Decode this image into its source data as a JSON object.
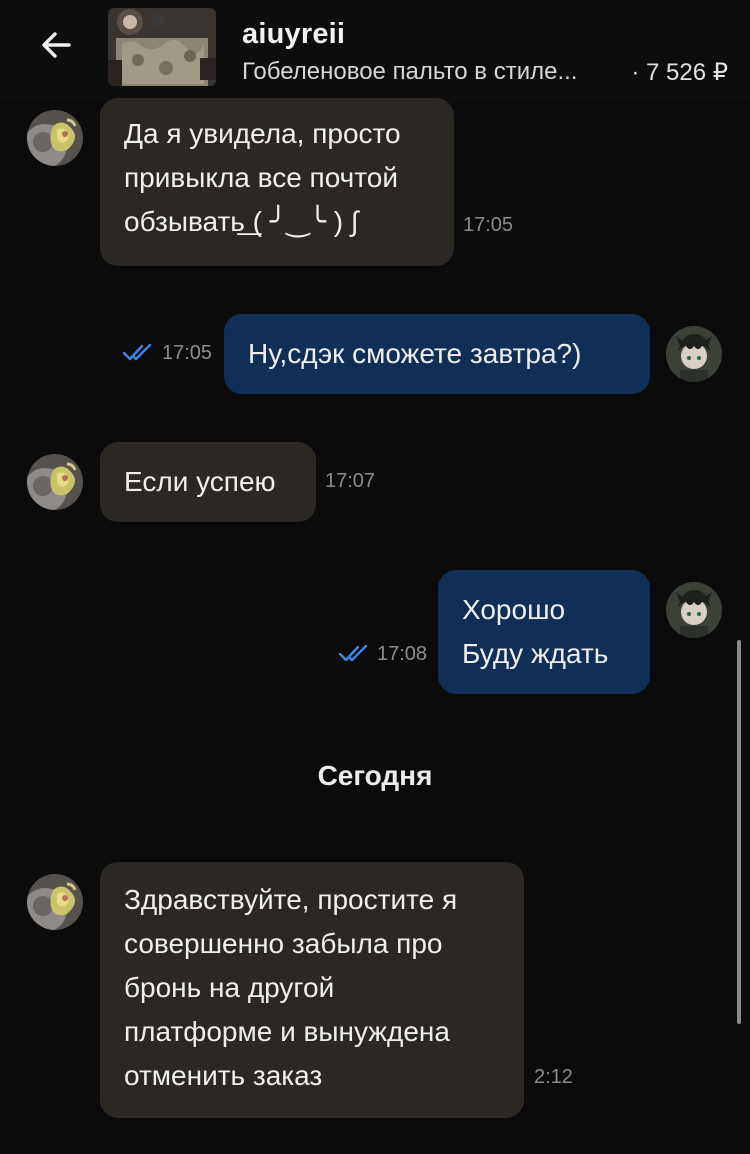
{
  "header": {
    "username": "aiuyreii",
    "product_title": "Гобеленовое пальто в стиле...",
    "price": "· 7 526 ₽",
    "back_icon": "arrow-left-icon"
  },
  "messages": [
    {
      "direction": "in",
      "lines": [
        "Да я увидела, просто",
        "привыкла все почтой",
        "обзывать͟  ( ╯‿╰ )  ∫"
      ],
      "time": "17:05"
    },
    {
      "direction": "out",
      "lines": [
        "Ну,сдэк сможете завтра?)"
      ],
      "time": "17:05",
      "read": true
    },
    {
      "direction": "in",
      "lines": [
        "Если успею"
      ],
      "time": "17:07"
    },
    {
      "direction": "out",
      "lines": [
        "Хорошо",
        "Буду ждать"
      ],
      "time": "17:08",
      "read": true
    },
    {
      "direction": "in",
      "lines": [
        "Здравствуйте, простите я",
        "совершенно забыла про",
        "бронь на другой",
        "платформе и вынуждена",
        "отменить заказ"
      ],
      "time": "2:12"
    }
  ],
  "day_separator": "Сегодня",
  "colors": {
    "incoming_bubble": "#2b2824",
    "outgoing_bubble": "#0f2f57",
    "read_ticks": "#3d86e8",
    "background": "#0b0b0c"
  }
}
